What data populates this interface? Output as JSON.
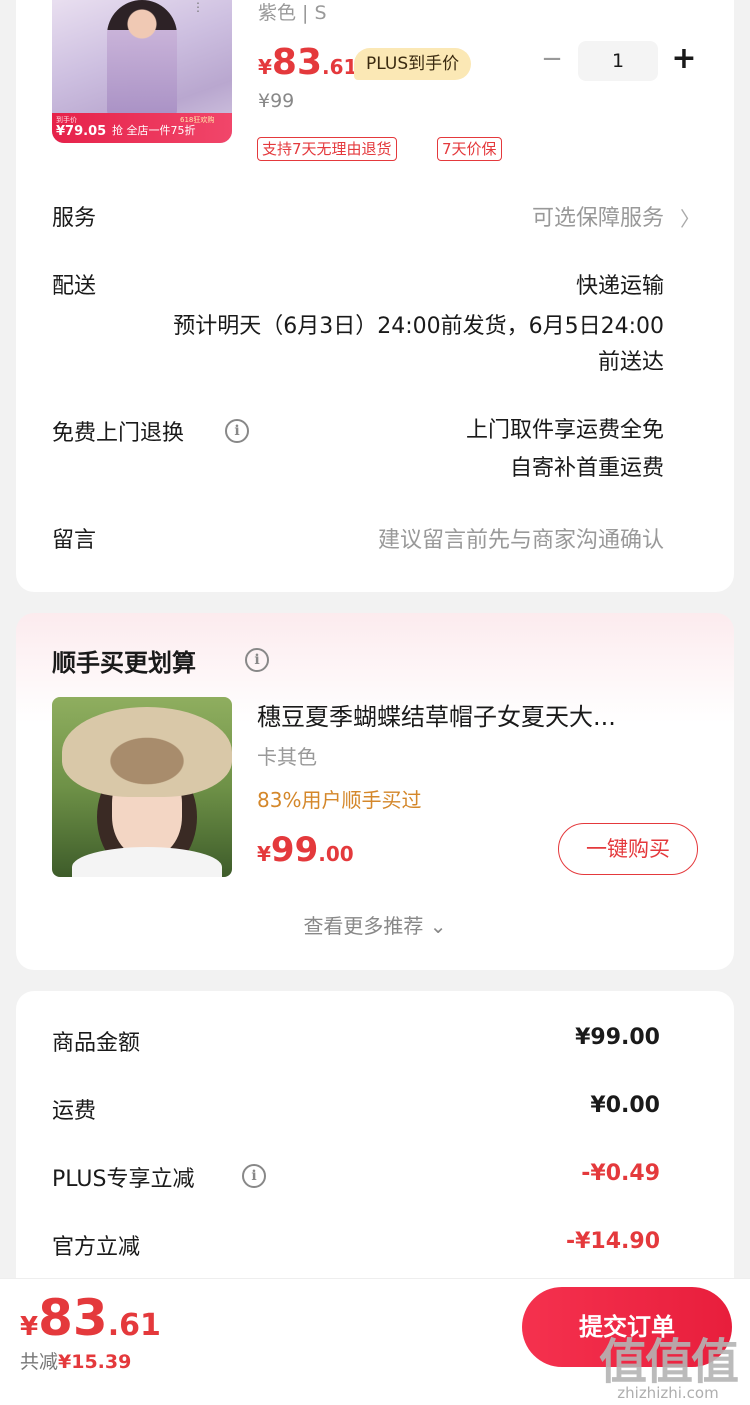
{
  "product": {
    "spec": "紫色 | S",
    "promo": {
      "line1": "到手价",
      "price": "¥79.05",
      "rush": "抢",
      "deal": "全店一件75折",
      "event": "618狂欢购"
    },
    "price": {
      "yen": "¥",
      "int": "83",
      "dec": ".61"
    },
    "plus_tag": "PLUS到手价",
    "original_price": "¥99",
    "tags": [
      "支持7天无理由退货",
      "7天价保"
    ],
    "quantity": "1",
    "minus": "−",
    "plus": "+"
  },
  "rows": {
    "service": {
      "label": "服务",
      "value": "可选保障服务"
    },
    "delivery": {
      "label": "配送",
      "method": "快递运输",
      "line1": "预计明天（6月3日）24:00前发货，6月5日24:00",
      "line2": "前送达"
    },
    "return": {
      "label": "免费上门退换",
      "line1": "上门取件享运费全免",
      "line2": "自寄补首重运费"
    },
    "message": {
      "label": "留言",
      "placeholder": "建议留言前先与商家沟通确认"
    }
  },
  "recommend": {
    "title": "顺手买更划算",
    "item": {
      "title": "穗豆夏季蝴蝶结草帽子女夏天大...",
      "color": "卡其色",
      "rate": "83%用户顺手买过",
      "price": {
        "yen": "¥",
        "int": "99",
        "dec": ".00"
      },
      "buy_label": "一键购买"
    },
    "more": "查看更多推荐"
  },
  "summary": [
    {
      "label": "商品金额",
      "value": "¥99.00",
      "red": false,
      "info": false
    },
    {
      "label": "运费",
      "value": "¥0.00",
      "red": false,
      "info": false
    },
    {
      "label": "PLUS专享立减",
      "value": "-¥0.49",
      "red": true,
      "info": true
    },
    {
      "label": "官方立减",
      "value": "-¥14.90",
      "red": true,
      "info": false
    }
  ],
  "bottom": {
    "total": {
      "yen": "¥",
      "int": "83",
      "dec": ".61"
    },
    "saved_label": "共减",
    "saved_amount": "¥15.39",
    "submit": "提交订单"
  },
  "watermark": {
    "logo": "值值值",
    "text": "zhizhizhi.com"
  },
  "icons": {
    "info": "i",
    "chevron": "〉",
    "chevron_down": "⌄",
    "menu": "⋮"
  },
  "colors": {
    "accent": "#e4393c",
    "plus_bg": "#fbe8b5",
    "rate": "#d4872a"
  }
}
